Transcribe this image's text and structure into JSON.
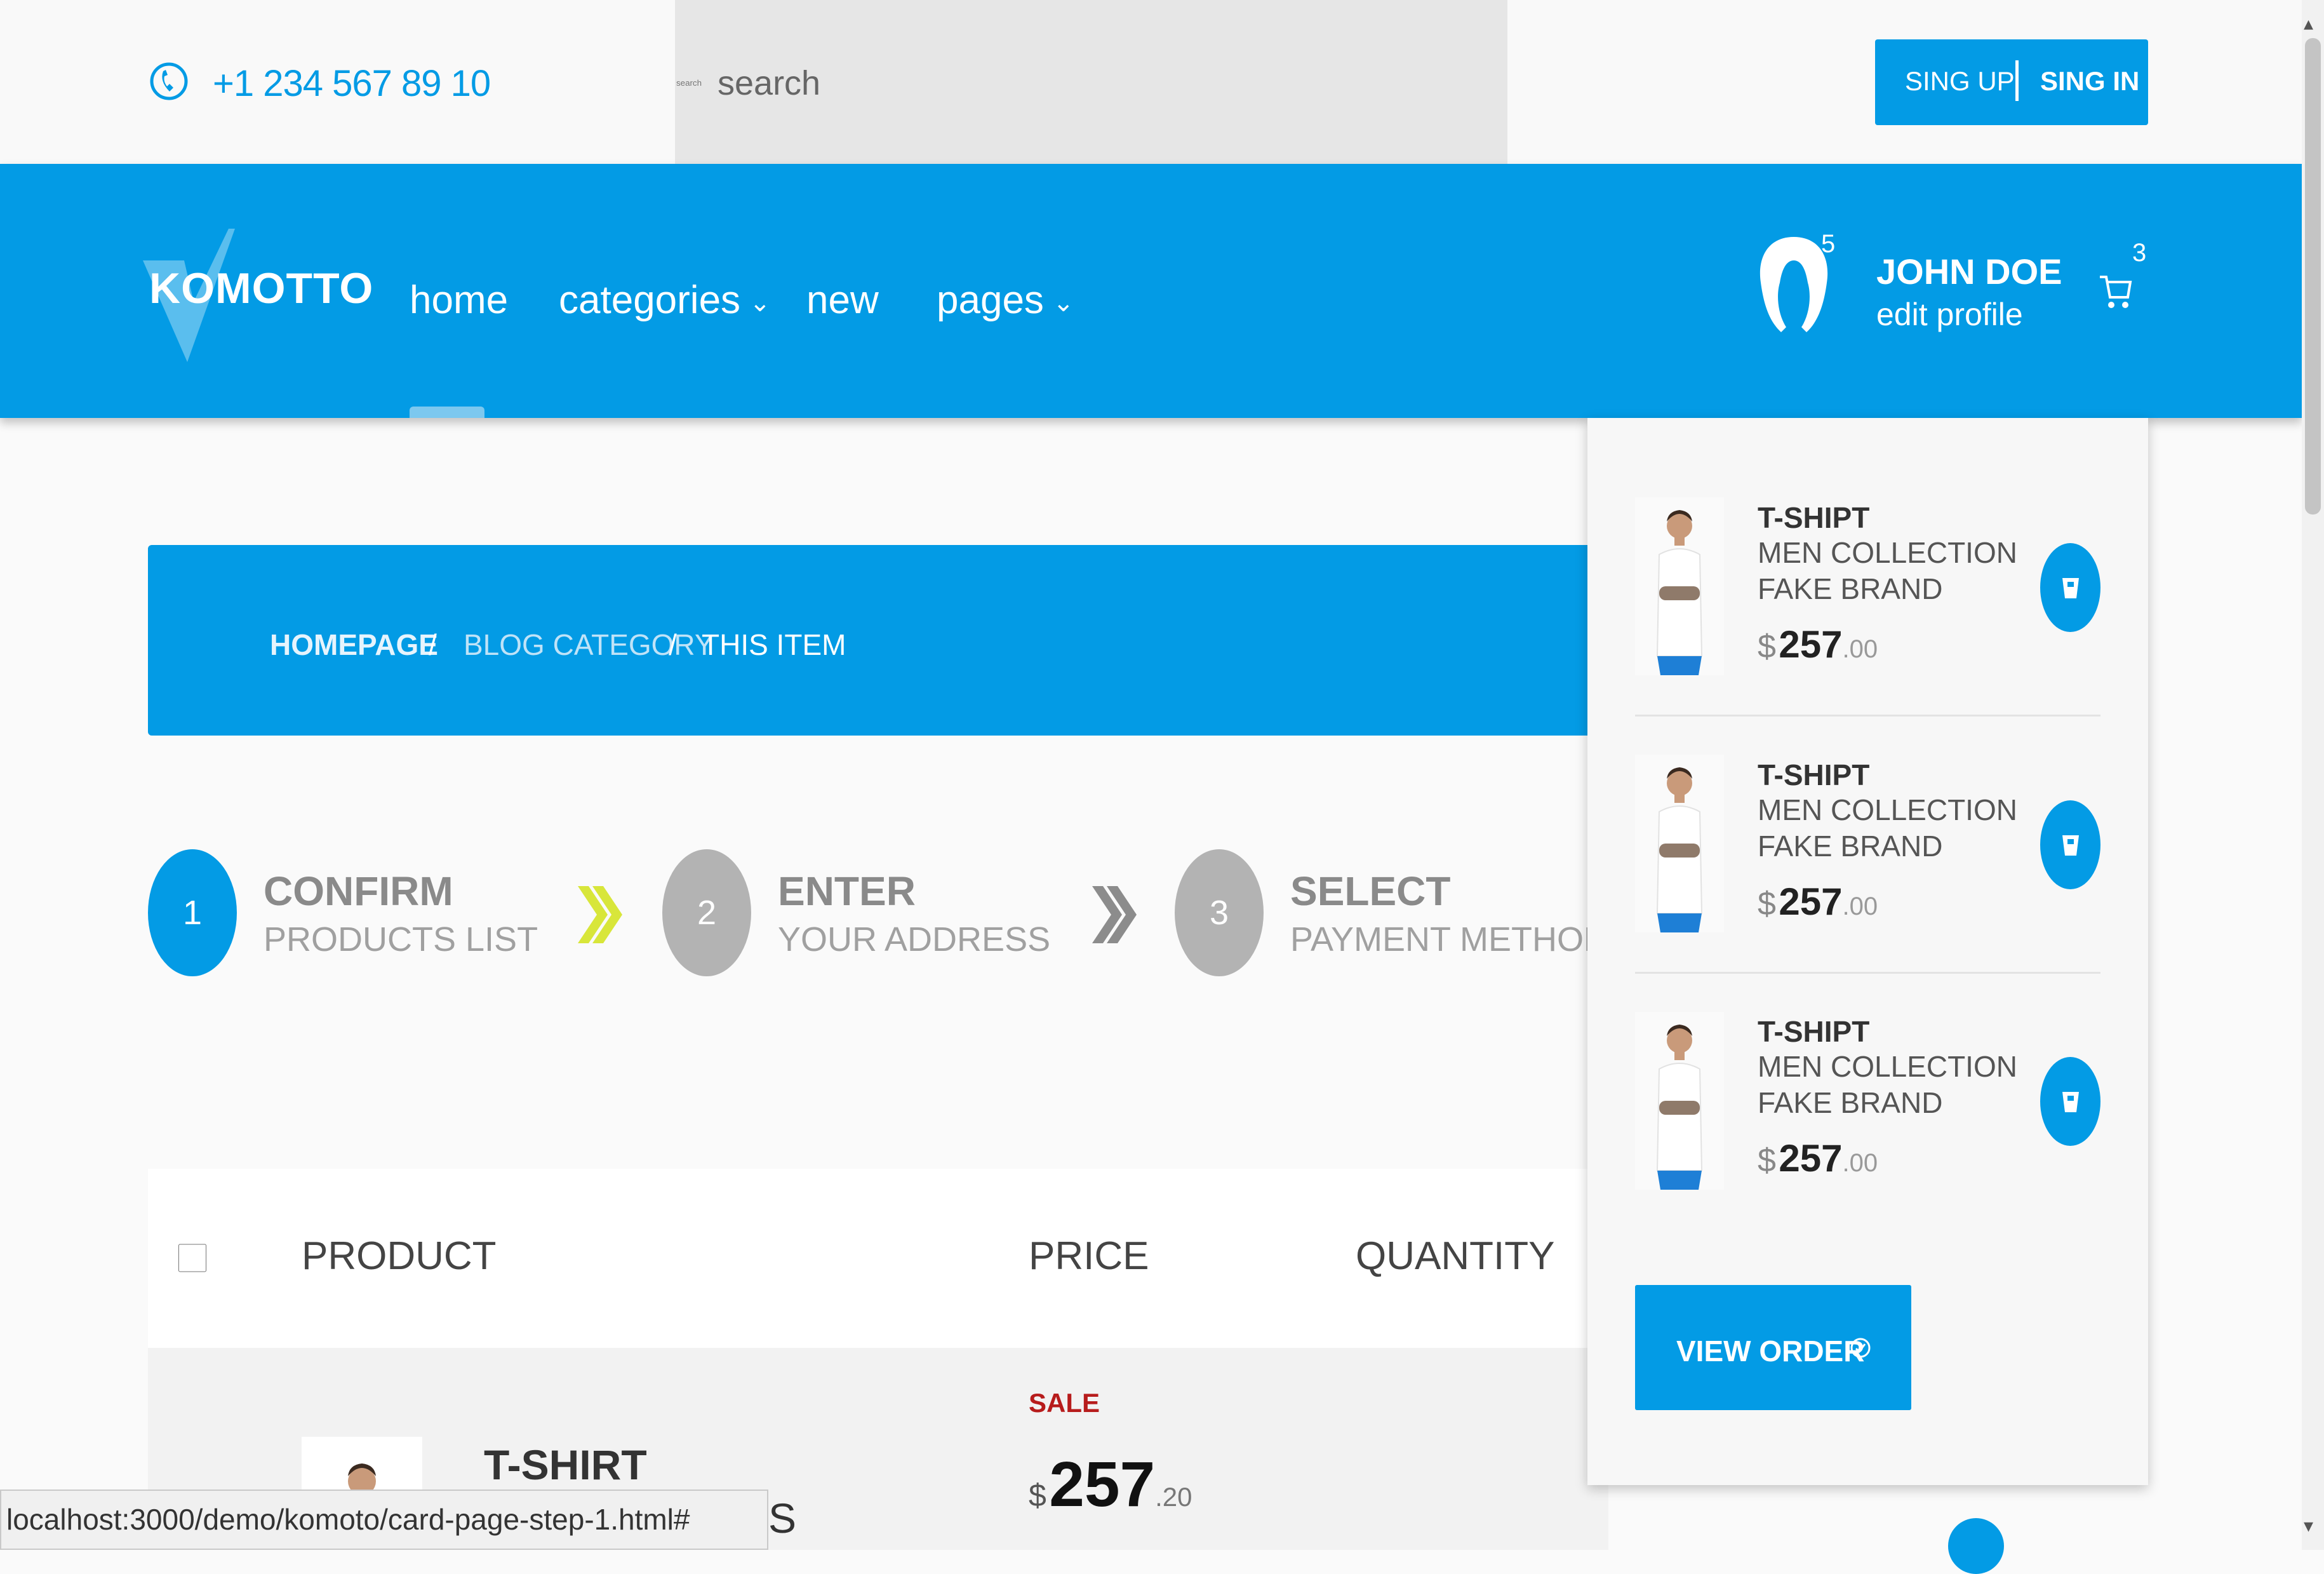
{
  "topbar": {
    "phone": "+1 234 567 89 10",
    "search_placeholder": "search",
    "signup_label": "SING UP",
    "signin_label": "SING IN"
  },
  "nav": {
    "logo": "KOMOTTO",
    "items": [
      "home",
      "categories",
      "new",
      "pages"
    ],
    "user": {
      "name": "JOHN DOE",
      "edit": "edit profile",
      "notifications": "5"
    },
    "cart_count": "3"
  },
  "breadcrumb": {
    "home": "HOMEPAGE",
    "separator": "/",
    "category": "BLOG CATEGORY",
    "current": "THIS ITEM"
  },
  "steps": [
    {
      "number": "1",
      "title": "CONFIRM",
      "subtitle": "PRODUCTS LIST"
    },
    {
      "number": "2",
      "title": "ENTER",
      "subtitle": "YOUR ADDRESS"
    },
    {
      "number": "3",
      "title": "SELECT",
      "subtitle": "PAYMENT METHOD"
    }
  ],
  "table": {
    "headers": [
      "PRODUCT",
      "PRICE",
      "QUANTITY"
    ],
    "row": {
      "name": "T-SHIRT",
      "name_tail": "S",
      "sale": "SALE",
      "currency": "$",
      "price_int": "257",
      "price_dec": ".20"
    }
  },
  "cart": {
    "items": [
      {
        "title": "T-SHIPT",
        "line1": "MEN COLLECTION",
        "line2": "FAKE BRAND",
        "currency": "$",
        "price_int": "257",
        "price_dec": ".00"
      },
      {
        "title": "T-SHIPT",
        "line1": "MEN COLLECTION",
        "line2": "FAKE BRAND",
        "currency": "$",
        "price_int": "257",
        "price_dec": ".00"
      },
      {
        "title": "T-SHIPT",
        "line1": "MEN COLLECTION",
        "line2": "FAKE BRAND",
        "currency": "$",
        "price_int": "257",
        "price_dec": ".00"
      }
    ],
    "view_order": "VIEW ORDER"
  },
  "status": {
    "url": "localhost:3000/demo/komoto/card-page-step-1.html#"
  },
  "colors": {
    "primary": "#039be5",
    "sale": "#b71c1c",
    "arrow_active": "#d8e63a",
    "inactive": "#b3b3b3"
  }
}
